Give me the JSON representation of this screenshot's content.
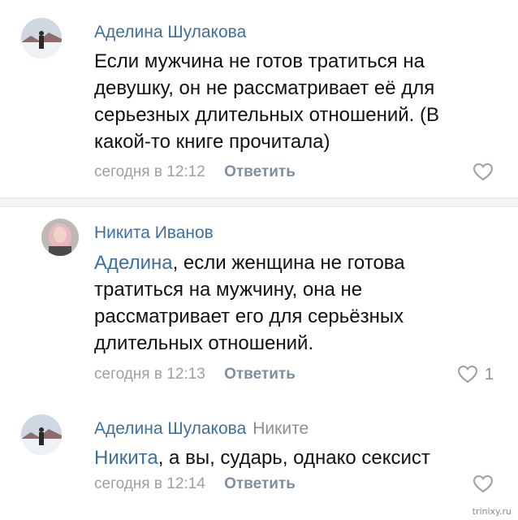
{
  "comments": [
    {
      "author": "Аделина Шулакова",
      "text": "Если мужчина не готов тратиться на девушку, он не рассматривает её для серьезных длительных отношений. (В какой-то книге прочитала)",
      "time": "сегодня в 12:12",
      "reply_label": "Ответить",
      "likes": ""
    },
    {
      "author": "Никита Иванов",
      "mention": "Аделина",
      "text": ", если женщина не готова тратиться на мужчину, она не рассматривает его для серьёзных длительных отношений.",
      "time": "сегодня в 12:13",
      "reply_label": "Ответить",
      "likes": "1"
    },
    {
      "author": "Аделина Шулакова",
      "reply_to": "Никите",
      "mention": "Никита",
      "text": ", а вы, сударь, однако сексист",
      "time": "сегодня в 12:14",
      "reply_label": "Ответить",
      "likes": ""
    }
  ],
  "icons": {
    "like": "heart-outline-icon",
    "avatar": "user-photo"
  },
  "colors": {
    "link": "#3f6f9e",
    "meta": "#9aa0a6",
    "reply_button": "#7e8fa3",
    "separator": "#f4f4f4"
  },
  "watermark": "trinixy.ru"
}
